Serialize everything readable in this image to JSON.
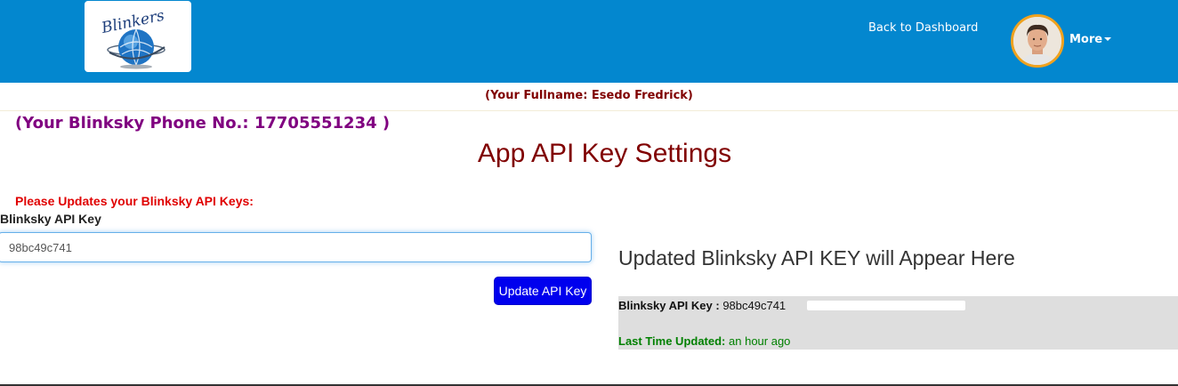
{
  "header": {
    "logo_text": "Blinkers",
    "nav_back_label": "Back to Dashboard",
    "more_label": "More",
    "bg_color": "#0387cf",
    "avatar_border_color": "#f0a21e"
  },
  "profile": {
    "fullname_line": "(Your Fullname: Esedo Fredrick)",
    "phone_line": "(Your Blinksky Phone No.: 17705551234 )"
  },
  "page": {
    "title": "App API Key Settings"
  },
  "form": {
    "notice": "Please Updates your Blinksky API Keys:",
    "field_label": "Blinksky API Key",
    "field_value": "98bc49c741",
    "submit_label": "Update API Key",
    "button_color": "#0000ee"
  },
  "result": {
    "heading": "Updated Blinksky API KEY will Appear Here",
    "key_label": "Blinksky API Key :",
    "key_value": "98bc49c741",
    "updated_label": "Last Time Updated:",
    "updated_value": "an hour ago"
  },
  "icons": {
    "logo": "globe-logo-icon",
    "avatar": "user-avatar",
    "caret": "caret-down-icon"
  }
}
